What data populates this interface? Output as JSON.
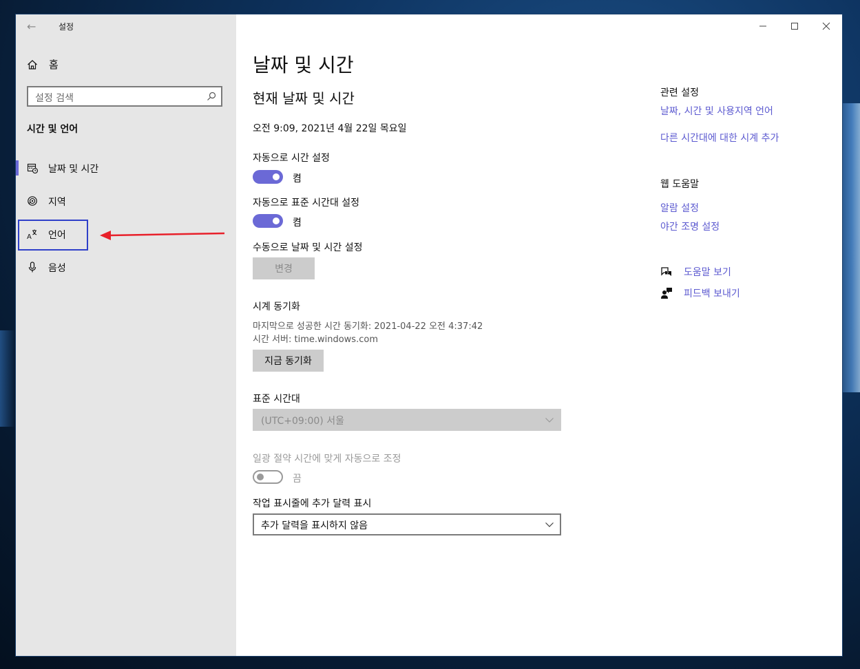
{
  "window": {
    "title": "설정"
  },
  "sidebar": {
    "home_label": "홈",
    "search_placeholder": "설정 검색",
    "section_title": "시간 및 언어",
    "items": [
      {
        "label": "날짜 및 시간",
        "icon": "calendar-clock-icon",
        "selected": true
      },
      {
        "label": "지역",
        "icon": "globe-icon",
        "selected": false
      },
      {
        "label": "언어",
        "icon": "language-icon",
        "selected": false
      },
      {
        "label": "음성",
        "icon": "microphone-icon",
        "selected": false
      }
    ]
  },
  "main": {
    "page_title": "날짜 및 시간",
    "current_heading": "현재 날짜 및 시간",
    "current_datetime": "오전 9:09, 2021년 4월 22일 목요일",
    "auto_time": {
      "label": "자동으로 시간 설정",
      "state": "켬"
    },
    "auto_timezone": {
      "label": "자동으로 표준 시간대 설정",
      "state": "켬"
    },
    "manual": {
      "label": "수동으로 날짜 및 시간 설정",
      "button": "변경"
    },
    "sync": {
      "heading": "시계 동기화",
      "last_sync": "마지막으로 성공한 시간 동기화: 2021-04-22 오전 4:37:42",
      "server": "시간 서버: time.windows.com",
      "button": "지금 동기화"
    },
    "timezone": {
      "label": "표준 시간대",
      "value": "(UTC+09:00) 서울"
    },
    "dst": {
      "label": "일광 절약 시간에 맞게 자동으로 조정",
      "state": "끔"
    },
    "calendar": {
      "label": "작업 표시줄에 추가 달력 표시",
      "value": "추가 달력을 표시하지 않음"
    }
  },
  "related": {
    "heading": "관련 설정",
    "links": [
      "날짜, 시간 및 사용지역 언어",
      "다른 시간대에 대한 시계 추가"
    ]
  },
  "web_help": {
    "heading": "웹 도움말",
    "links": [
      "알람 설정",
      "야간 조명 설정"
    ]
  },
  "help": {
    "get_help": "도움말 보기",
    "feedback": "피드백 보내기"
  },
  "colors": {
    "accent": "#6b69d6",
    "link": "#5c5ad0",
    "highlight_box": "#2e3fc9",
    "arrow": "#e8202a"
  }
}
